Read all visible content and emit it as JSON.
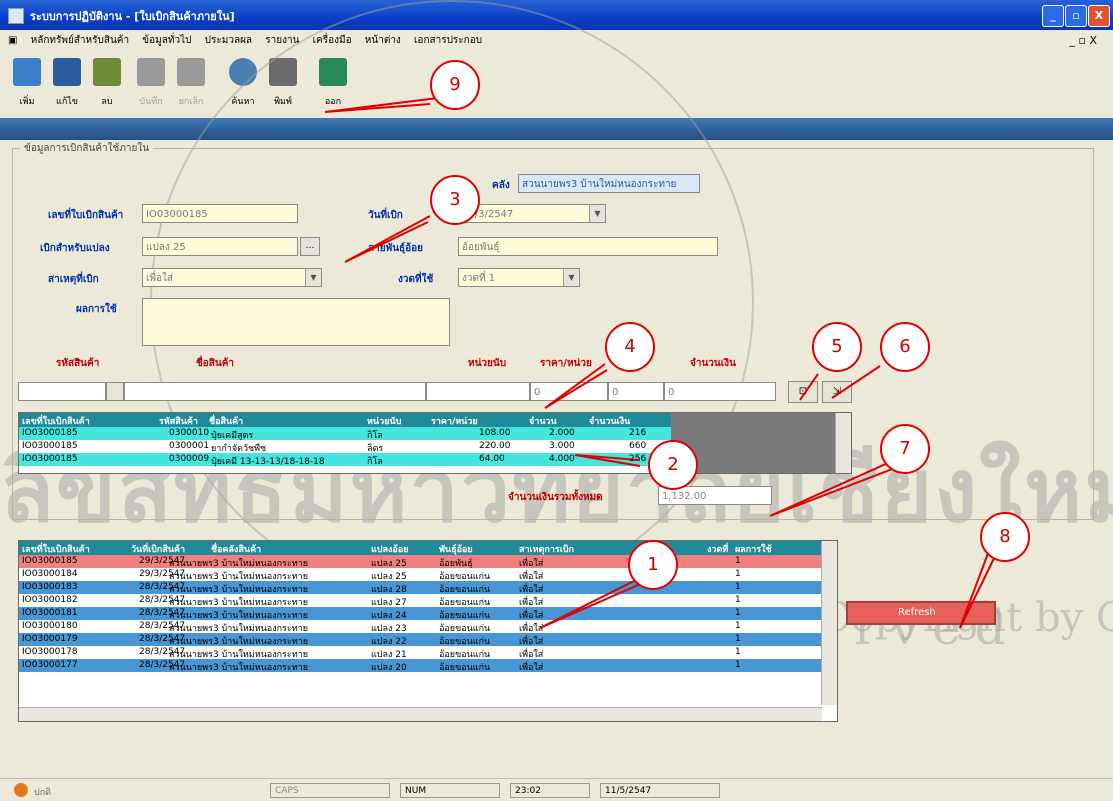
{
  "window": {
    "title": "ระบบการปฏิบัติงาน - [ใบเบิกสินค้าภายใน]",
    "min": "_",
    "max": "▫",
    "close": "X"
  },
  "menu": {
    "items": [
      "หลักทรัพย์สำหรับสินค้า",
      "ข้อมูลทั่วไป",
      "ประมวลผล",
      "รายงาน",
      "เครื่องมือ",
      "หน้าต่าง",
      "เอกสารประกอบ"
    ],
    "sys_controls": "_ ▫ X"
  },
  "toolbar": {
    "buttons": [
      {
        "label": "เพิ่ม",
        "icon": "add-icon",
        "color": "#3a7fc8",
        "enabled": true
      },
      {
        "label": "แก้ไข",
        "icon": "save-icon",
        "color": "#2b5d9e",
        "enabled": true
      },
      {
        "label": "ลบ",
        "icon": "trash-icon",
        "color": "#6e8a3a",
        "enabled": true
      },
      {
        "label": "บันทึก",
        "icon": "disk-icon",
        "color": "#9a9a9a",
        "enabled": false
      },
      {
        "label": "ยกเลิก",
        "icon": "cancel-icon",
        "color": "#9a9a9a",
        "enabled": false
      },
      {
        "label": "ค้นหา",
        "icon": "search-icon",
        "color": "#4a7fb0",
        "enabled": true
      },
      {
        "label": "พิมพ์",
        "icon": "printer-icon",
        "color": "#6b6b6b",
        "enabled": true
      },
      {
        "label": "ออก",
        "icon": "exit-icon",
        "color": "#2a8a5a",
        "enabled": true
      }
    ]
  },
  "group": {
    "label": "ข้อมูลการเบิกสินค้าใช้ภายใน"
  },
  "form": {
    "warehouse_label": "คลัง",
    "warehouse_value": "สวนนายพร3 บ้านใหม่หนองกระทาย",
    "doc_no_label": "เลขที่ใบเบิกสินค้า",
    "doc_no": "IO03000185",
    "date_label": "วันที่เบิก",
    "date": "29/3/2547",
    "for_label": "เบิกสำหรับแปลง",
    "for_value": "แปลง 25",
    "crop_label": "ลายพันธุ์อ้อย",
    "crop_value": "อ้อยพันธุ์",
    "reason_label": "สาเหตุที่เบิก",
    "reason_value": "เพื่อใส่",
    "round_label": "งวดที่ใช้",
    "round_value": "งวดที่ 1",
    "result_label": "ผลการใช้"
  },
  "entry": {
    "code_label": "รหัสสินค้า",
    "name_label": "ชื่อสินค้า",
    "unit_label": "หน่วยนับ",
    "price_label": "ราคา/หน่วย",
    "amount_label": "จำนวนเงิน",
    "qty_value": "0",
    "price_value": "0",
    "amount_value": "0"
  },
  "items_table": {
    "columns": [
      "เลขที่ใบเบิกสินค้า",
      "รหัสสินค้า",
      "ชื่อสินค้า",
      "หน่วยนับ",
      "ราคา/หน่วย",
      "จำนวน",
      "จำนวนเงิน"
    ],
    "rows": [
      [
        "IO03000185",
        "0300010",
        "ปุ๋ยเคมีสูตร",
        "กิโล",
        "108.00",
        "2.000",
        "216"
      ],
      [
        "IO03000185",
        "0300001",
        "ยากำจัดวัชพืช",
        "ลิตร",
        "220.00",
        "3.000",
        "660"
      ],
      [
        "IO03000185",
        "0300009",
        "ปุ๋ยเคมี 13-13-13/18-18-18",
        "กิโล",
        "64.00",
        "4.000",
        "256"
      ]
    ]
  },
  "total": {
    "label": "จำนวนเงินรวมทั้งหมด",
    "value": "1,132.00"
  },
  "docs_table": {
    "columns": [
      "เลขที่ใบเบิกสินค้า",
      "วันที่เบิกสินค้า",
      "ชื่อคลังสินค้า",
      "แปลงอ้อย",
      "พันธุ์อ้อย",
      "สาเหตุการเบิก",
      "งวดที่",
      "ผลการใช้"
    ],
    "rows": [
      [
        "IO03000185",
        "29/3/2547",
        "สวนนายพร3 บ้านใหม่หนองกระทาย",
        "แปลง 25",
        "อ้อยพันธุ์",
        "เพื่อใส่",
        "1",
        ""
      ],
      [
        "IO03000184",
        "29/3/2547",
        "สวนนายพร3 บ้านใหม่หนองกระทาย",
        "แปลง 25",
        "อ้อยขอนแก่น",
        "เพื่อใส่",
        "1",
        ""
      ],
      [
        "IO03000183",
        "28/3/2547",
        "สวนนายพร3 บ้านใหม่หนองกระทาย",
        "แปลง 28",
        "อ้อยขอนแก่น",
        "เพื่อใส่",
        "1",
        ""
      ],
      [
        "IO03000182",
        "28/3/2547",
        "สวนนายพร3 บ้านใหม่หนองกระทาย",
        "แปลง 27",
        "อ้อยขอนแก่น",
        "เพื่อใส่",
        "1",
        ""
      ],
      [
        "IO03000181",
        "28/3/2547",
        "สวนนายพร3 บ้านใหม่หนองกระทาย",
        "แปลง 24",
        "อ้อยขอนแก่น",
        "เพื่อใส่",
        "1",
        ""
      ],
      [
        "IO03000180",
        "28/3/2547",
        "สวนนายพร3 บ้านใหม่หนองกระทาย",
        "แปลง 23",
        "อ้อยขอนแก่น",
        "เพื่อใส่",
        "1",
        ""
      ],
      [
        "IO03000179",
        "28/3/2547",
        "สวนนายพร3 บ้านใหม่หนองกระทาย",
        "แปลง 22",
        "อ้อยขอนแก่น",
        "เพื่อใส่",
        "1",
        ""
      ],
      [
        "IO03000178",
        "28/3/2547",
        "สวนนายพร3 บ้านใหม่หนองกระทาย",
        "แปลง 21",
        "อ้อยขอนแก่น",
        "เพื่อใส่",
        "1",
        ""
      ],
      [
        "IO03000177",
        "28/3/2547",
        "สวนนายพร3 บ้านใหม่หนองกระทาย",
        "แปลง 20",
        "อ้อยขอนแก่น",
        "เพื่อใส่",
        "1",
        ""
      ]
    ]
  },
  "refresh_label": "Refresh",
  "callouts": [
    "1",
    "2",
    "3",
    "4",
    "5",
    "6",
    "7",
    "8",
    "9"
  ],
  "watermark": {
    "line1": "ลิขสิทธิ์มหาวิทยาลัยเชียงใหม่",
    "line2": "Copyright by Chiang Mai University",
    "line3": "All rights reserved"
  },
  "status": {
    "user": "ปกติ",
    "caps": "CAPS",
    "num": "NUM",
    "time": "23:02",
    "date": "11/5/2547"
  }
}
